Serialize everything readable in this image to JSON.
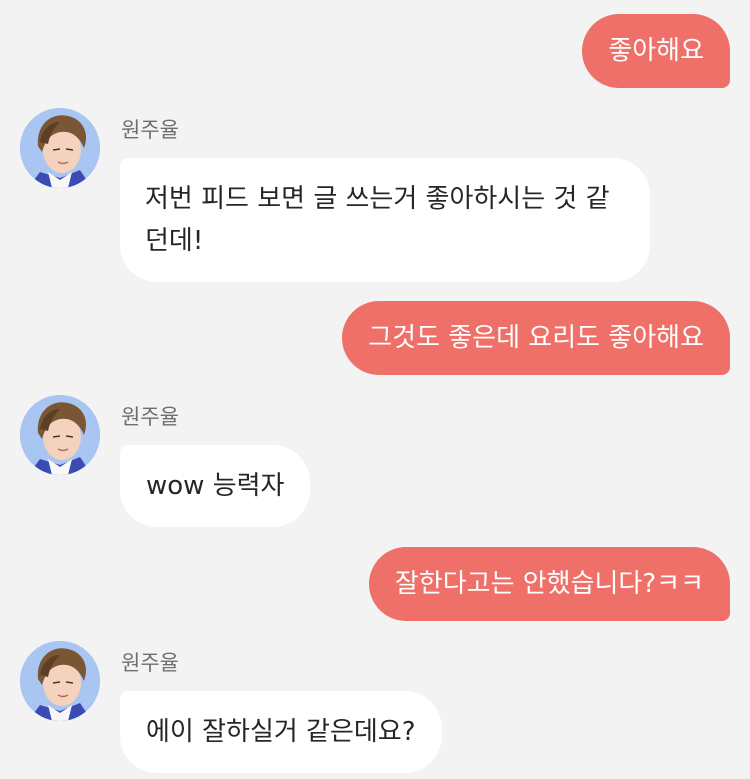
{
  "chat": {
    "messages": [
      {
        "id": "m1",
        "from": "me",
        "text": "좋아해요"
      },
      {
        "id": "m2",
        "from": "them",
        "sender": "원주율",
        "text": "저번 피드 보면 글 쓰는거 좋아하시는 것 같던데!"
      },
      {
        "id": "m3",
        "from": "me",
        "text": "그것도 좋은데 요리도 좋아해요"
      },
      {
        "id": "m4",
        "from": "them",
        "sender": "원주율",
        "text": "wow 능력자"
      },
      {
        "id": "m5",
        "from": "me",
        "text": "잘한다고는 안했습니다?ㅋㅋ"
      },
      {
        "id": "m6",
        "from": "them",
        "sender": "원주율",
        "text": "에이 잘하실거 같은데요?"
      }
    ]
  },
  "colors": {
    "background": "#f3f3f3",
    "my_bubble": "#ee7068",
    "their_bubble": "#ffffff",
    "sender_name": "#6f6f6f"
  },
  "icons": {
    "avatar": "avatar-icon"
  }
}
